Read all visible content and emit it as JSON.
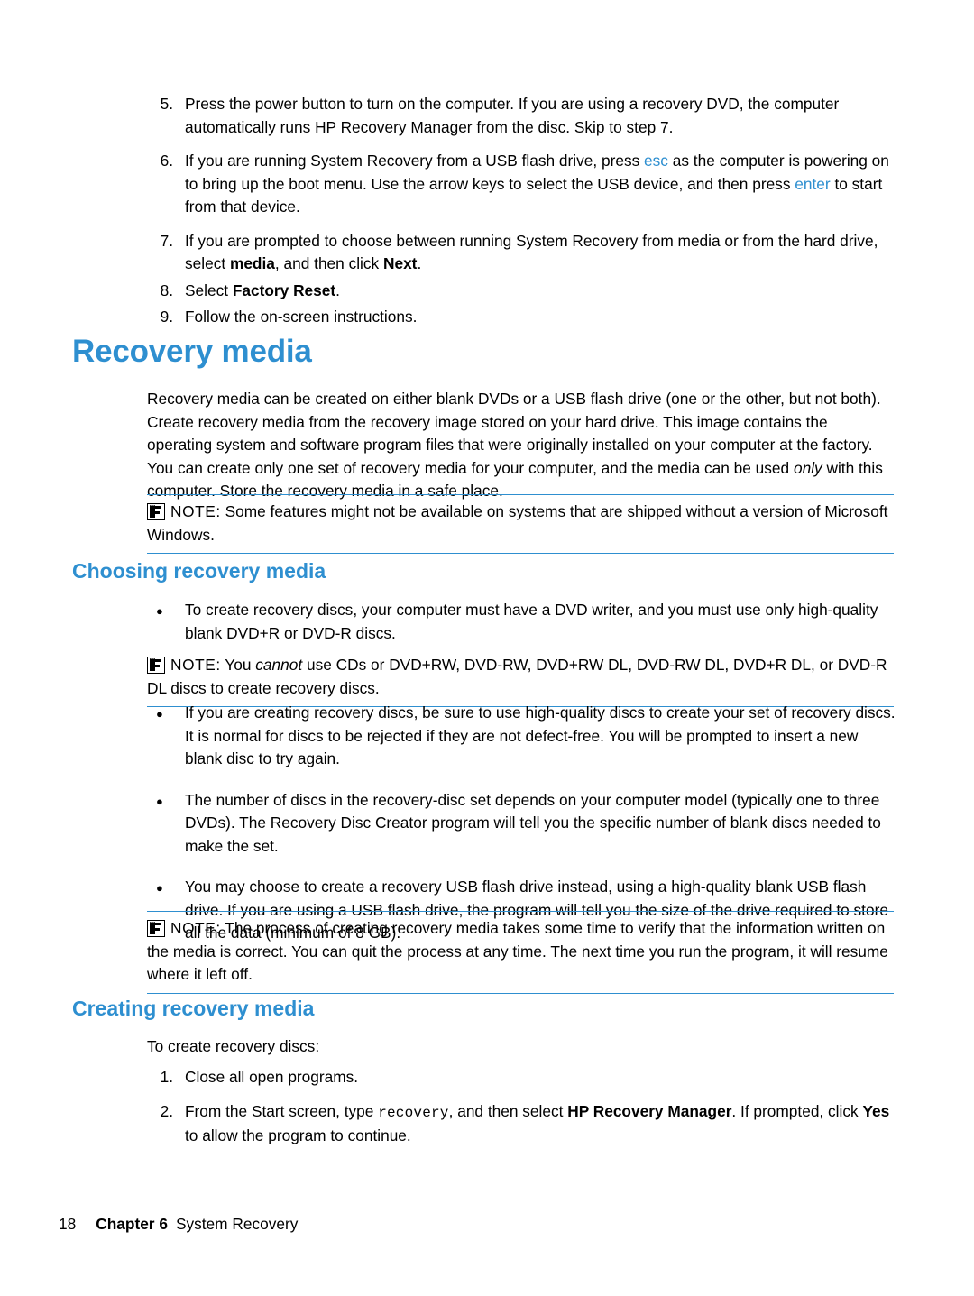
{
  "steps_top": [
    {
      "num": "5.",
      "parts": [
        {
          "t": "Press the power button to turn on the computer. If you are using a recovery DVD, the computer automatically runs HP Recovery Manager from the disc. Skip to step 7.",
          "s": "plain"
        }
      ]
    },
    {
      "num": "6.",
      "parts": [
        {
          "t": "If you are running System Recovery from a USB flash drive, press ",
          "s": "plain"
        },
        {
          "t": "esc",
          "s": "blue"
        },
        {
          "t": " as the computer is powering on to bring up the boot menu. Use the arrow keys to select the USB device, and then press ",
          "s": "plain"
        },
        {
          "t": "enter",
          "s": "blue"
        },
        {
          "t": " to start from that device.",
          "s": "plain"
        }
      ]
    },
    {
      "num": "7.",
      "parts": [
        {
          "t": "If you are prompted to choose between running System Recovery from media or from the hard drive, select ",
          "s": "plain"
        },
        {
          "t": "media",
          "s": "bold"
        },
        {
          "t": ", and then click ",
          "s": "plain"
        },
        {
          "t": "Next",
          "s": "bold"
        },
        {
          "t": ".",
          "s": "plain"
        }
      ]
    },
    {
      "num": "8.",
      "parts": [
        {
          "t": "Select ",
          "s": "plain"
        },
        {
          "t": "Factory Reset",
          "s": "bold"
        },
        {
          "t": ".",
          "s": "plain"
        }
      ]
    },
    {
      "num": "9.",
      "parts": [
        {
          "t": "Follow the on-screen instructions.",
          "s": "plain"
        }
      ]
    }
  ],
  "heading_main": "Recovery media",
  "intro_paragraph": [
    {
      "t": "Recovery media can be created on either blank DVDs or a USB flash drive (one or the other, but not both). Create recovery media from the recovery image stored on your hard drive. This image contains the operating system and software program files that were originally installed on your computer at the factory. You can create only one set of recovery media for your computer, and the media can be used ",
      "s": "plain"
    },
    {
      "t": "only",
      "s": "italic"
    },
    {
      "t": " with this computer. Store the recovery media in a safe place.",
      "s": "plain"
    }
  ],
  "note1": {
    "label": "NOTE:",
    "parts": [
      {
        "t": "  Some features might not be available on systems that are shipped without a version of Microsoft Windows.",
        "s": "plain"
      }
    ]
  },
  "heading_choosing": "Choosing recovery media",
  "bullets1": [
    {
      "parts": [
        {
          "t": "To create recovery discs, your computer must have a DVD writer, and you must use only high-quality blank DVD+R or DVD-R discs.",
          "s": "plain"
        }
      ]
    }
  ],
  "note2": {
    "label": "NOTE:",
    "parts": [
      {
        "t": "  You ",
        "s": "plain"
      },
      {
        "t": "cannot",
        "s": "italic"
      },
      {
        "t": " use CDs or DVD+RW, DVD-RW, DVD+RW DL, DVD-RW DL, DVD+R DL, or DVD-R DL discs to create recovery discs.",
        "s": "plain"
      }
    ]
  },
  "bullets2": [
    {
      "parts": [
        {
          "t": "If you are creating recovery discs, be sure to use high-quality discs to create your set of recovery discs. It is normal for discs to be rejected if they are not defect-free. You will be prompted to insert a new blank disc to try again.",
          "s": "plain"
        }
      ]
    },
    {
      "parts": [
        {
          "t": "The number of discs in the recovery-disc set depends on your computer model (typically one to three DVDs). The Recovery Disc Creator program will tell you the specific number of blank discs needed to make the set.",
          "s": "plain"
        }
      ]
    },
    {
      "parts": [
        {
          "t": "You may choose to create a recovery USB flash drive instead, using a high-quality blank USB flash drive. If you are using a USB flash drive, the program will tell you the size of the drive required to store all the data (minimum of 8 GB).",
          "s": "plain"
        }
      ]
    }
  ],
  "note3": {
    "label": "NOTE:",
    "parts": [
      {
        "t": "  The process of creating recovery media takes some time to verify that the information written on the media is correct. You can quit the process at any time. The next time you run the program, it will resume where it left off.",
        "s": "plain"
      }
    ]
  },
  "heading_creating": "Creating recovery media",
  "to_create_line": "To create recovery discs:",
  "steps_bottom": [
    {
      "num": "1.",
      "parts": [
        {
          "t": "Close all open programs.",
          "s": "plain"
        }
      ]
    },
    {
      "num": "2.",
      "parts": [
        {
          "t": "From the Start screen, type ",
          "s": "plain"
        },
        {
          "t": "recovery",
          "s": "mono"
        },
        {
          "t": ", and then select ",
          "s": "plain"
        },
        {
          "t": "HP Recovery Manager",
          "s": "bold"
        },
        {
          "t": ". If prompted, click ",
          "s": "plain"
        },
        {
          "t": "Yes",
          "s": "bold"
        },
        {
          "t": " to allow the program to continue.",
          "s": "plain"
        }
      ]
    }
  ],
  "footer": {
    "page_number": "18",
    "chapter_label": "Chapter 6",
    "chapter_title": "System Recovery"
  },
  "colors": {
    "accent": "#2e8fd0",
    "text": "#000000"
  },
  "bullet_glyph": "●"
}
